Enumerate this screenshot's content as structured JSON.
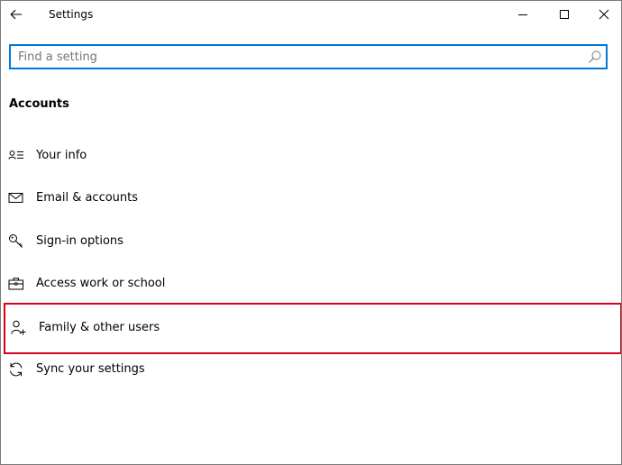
{
  "window": {
    "title": "Settings"
  },
  "search": {
    "placeholder": "Find a setting",
    "value": ""
  },
  "section": {
    "title": "Accounts"
  },
  "nav": {
    "items": [
      {
        "label": "Your info",
        "icon": "contact-card-icon"
      },
      {
        "label": "Email & accounts",
        "icon": "mail-icon"
      },
      {
        "label": "Sign-in options",
        "icon": "key-icon"
      },
      {
        "label": "Access work or school",
        "icon": "briefcase-icon"
      },
      {
        "label": "Family & other users",
        "icon": "add-person-icon",
        "highlighted": true
      },
      {
        "label": "Sync your settings",
        "icon": "sync-icon"
      }
    ]
  },
  "colors": {
    "accent": "#0078d7",
    "highlight_border": "#d9001b"
  }
}
